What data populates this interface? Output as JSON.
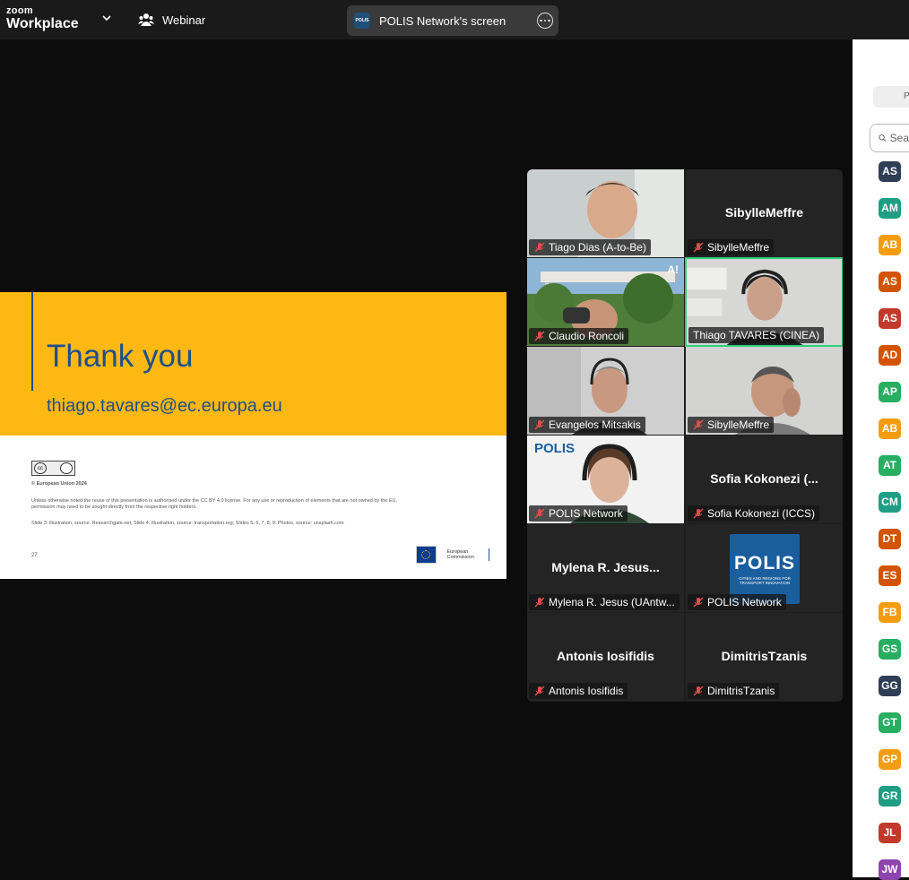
{
  "app": {
    "brand_top": "zoom",
    "brand_bottom": "Workplace",
    "mode_label": "Webinar"
  },
  "share_pill": {
    "label": "POLIS Network's screen",
    "icon": "polis-logo-icon",
    "logo_text": "POLIS"
  },
  "slide": {
    "title": "Thank you",
    "email": "thiago.tavares@ec.europa.eu",
    "copyright": "© European Union 2024",
    "license_note": "Unless otherwise noted the reuse of this presentation is authorised under the CC BY 4.0 license. For any use or reproduction of elements that are not owned by the EU, permission may need to be sought directly from the respective right holders.",
    "sources": "Slide 3: Illustration, source: Researchgate.net; Slide 4: Illustration, source: transportation.org; Slides 5, 6, 7, 8, 9: Photos, source: unsplash.com",
    "page_number": "27",
    "ec_label": "European Commission",
    "accent": "#fdb813",
    "text_color": "#1f4e8c"
  },
  "participants": [
    {
      "name": "Tiago Dias (A-to-Be)",
      "title": "",
      "video": "face"
    },
    {
      "name": "SibylleMeffre",
      "title": "SibylleMeffre",
      "video": "none"
    },
    {
      "name": "Claudio Roncoli",
      "title": "",
      "video": "outdoor"
    },
    {
      "name": "Thiago TAVARES (CINEA)",
      "title": "",
      "video": "face",
      "active": true
    },
    {
      "name": "Evangelos Mitsakis",
      "title": "",
      "video": "face"
    },
    {
      "name": "SibylleMeffre",
      "title": "",
      "video": "face"
    },
    {
      "name": "POLIS Network",
      "title": "",
      "video": "face"
    },
    {
      "name": "Sofia Kokonezi (ICCS)",
      "title": "Sofia Kokonezi (...",
      "video": "none"
    },
    {
      "name": "Mylena R. Jesus (UAntw...",
      "title": "Mylena R. Jesus...",
      "video": "none"
    },
    {
      "name": "POLIS Network",
      "title": "",
      "video": "logo"
    },
    {
      "name": "Antonis Iosifidis",
      "title": "Antonis Iosifidis",
      "video": "none"
    },
    {
      "name": "DimitrisTzanis",
      "title": "DimitrisTzanis",
      "video": "none"
    }
  ],
  "tile_media": {
    "polis_logo_title": "POLIS",
    "polis_logo_sub": "CITIES AND REGIONS FOR TRANSPORT INNOVATION",
    "polis_banner": "POLIS",
    "ai_badge": "A!"
  },
  "right_panel": {
    "button_label": "P",
    "search_placeholder": "Sea",
    "avatars": [
      {
        "initials": "AS",
        "color": "#2f3e55"
      },
      {
        "initials": "AM",
        "color": "#1f9e83"
      },
      {
        "initials": "AB",
        "color": "#f39c12"
      },
      {
        "initials": "AS",
        "color": "#d35400"
      },
      {
        "initials": "AS",
        "color": "#c0392b"
      },
      {
        "initials": "AD",
        "color": "#d35400"
      },
      {
        "initials": "AP",
        "color": "#27ae60"
      },
      {
        "initials": "AB",
        "color": "#f39c12"
      },
      {
        "initials": "AT",
        "color": "#27ae60"
      },
      {
        "initials": "CM",
        "color": "#1f9e83"
      },
      {
        "initials": "DT",
        "color": "#d35400"
      },
      {
        "initials": "ES",
        "color": "#d35400"
      },
      {
        "initials": "FB",
        "color": "#f39c12"
      },
      {
        "initials": "GS",
        "color": "#27ae60"
      },
      {
        "initials": "GG",
        "color": "#2f3e55"
      },
      {
        "initials": "GT",
        "color": "#27ae60"
      },
      {
        "initials": "GP",
        "color": "#f39c12"
      },
      {
        "initials": "GR",
        "color": "#1f9e83"
      },
      {
        "initials": "JL",
        "color": "#c0392b"
      },
      {
        "initials": "JW",
        "color": "#8e44ad"
      }
    ]
  }
}
